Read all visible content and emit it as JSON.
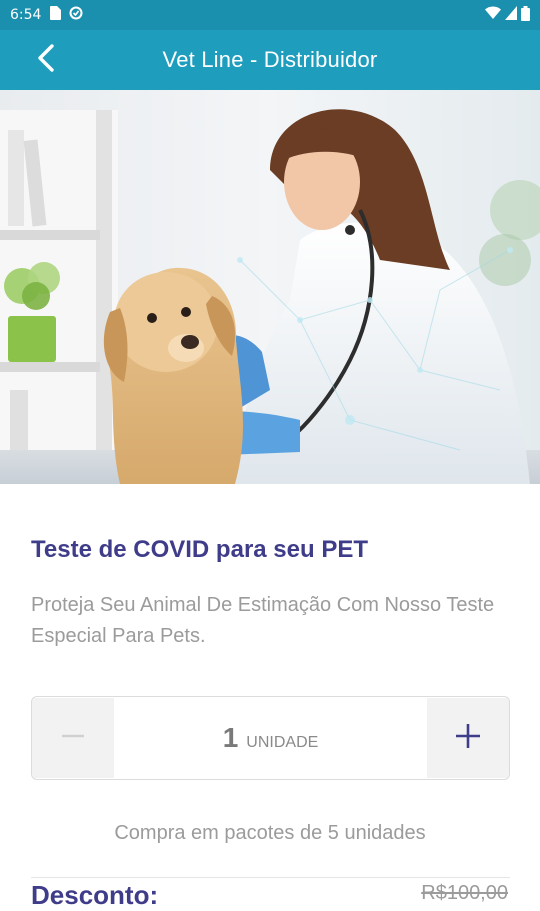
{
  "status_bar": {
    "time": "6:54"
  },
  "app_bar": {
    "title": "Vet Line - Distribuidor"
  },
  "product": {
    "title": "Teste de COVID para seu PET",
    "description": "Proteja Seu Animal De Estimação Com Nosso Teste Especial Para Pets."
  },
  "stepper": {
    "minus_symbol": "−",
    "plus_symbol": "+",
    "quantity": "1",
    "unit": "UNIDADE"
  },
  "pack_note": "Compra em pacotes de 5 unidades",
  "pricing": {
    "discount_label": "Desconto:",
    "old_price": "R$100,00"
  },
  "colors": {
    "app_bar": "#1f9dbd",
    "status_bar": "#1b8fae",
    "title_text": "#3f3d89",
    "muted_text": "#9b9b9b"
  }
}
